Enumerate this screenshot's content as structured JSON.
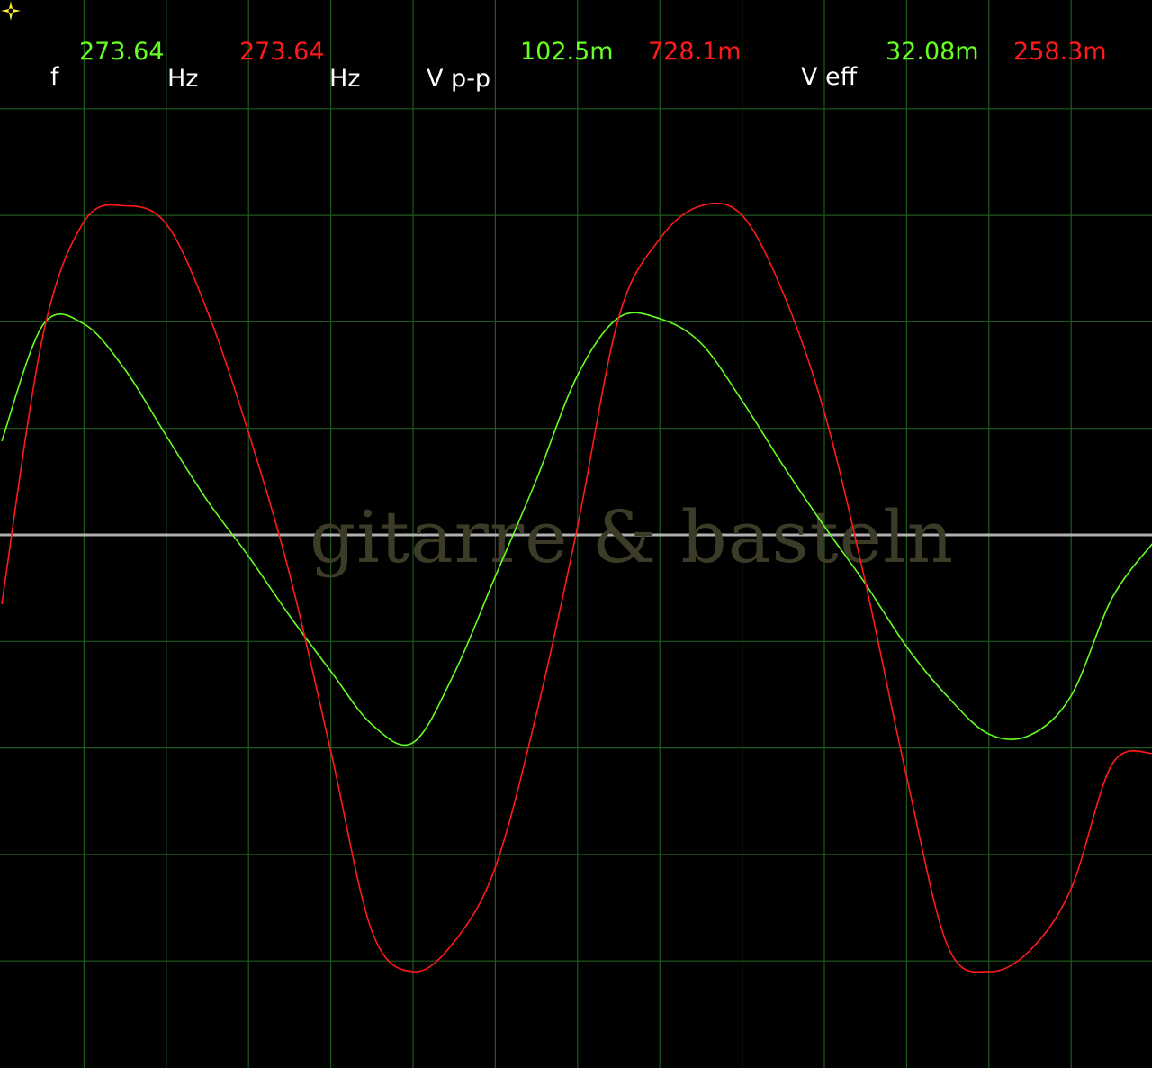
{
  "readout": {
    "freq_label": "f",
    "freq_ch1": "273.64",
    "freq_unit_ch1": "Hz",
    "freq_ch2": "273.64",
    "freq_unit_ch2": "Hz",
    "vpp_label": "V p-p",
    "vpp_ch1": "102.5m",
    "vpp_ch2": "728.1m",
    "veff_label": "V eff",
    "veff_ch1": "32.08m",
    "veff_ch2": "258.3m"
  },
  "watermark": "gitarre & basteln",
  "colors": {
    "background": "#000000",
    "grid": "#1e5a1e",
    "zero_line": "#b0b0b0",
    "channel_1": "#66ff22",
    "channel_2": "#ff1a1a",
    "cursor": "#ffee33",
    "label": "#ffffff"
  },
  "icons": {
    "cursor": "crosshair-cursor-icon"
  },
  "chart_data": {
    "type": "line",
    "grid": true,
    "series": [
      {
        "channel": 1,
        "x": [
          0,
          0.5,
          1,
          1.5,
          2,
          2.5,
          3,
          3.5,
          4,
          4.5,
          5,
          5.5,
          6,
          6.5,
          7,
          7.5,
          8,
          8.5,
          9,
          9.5,
          10,
          10.5,
          11,
          11.5,
          12,
          12.5,
          13,
          13.5,
          14
        ],
        "y": [
          0.88,
          1.97,
          1.98,
          1.55,
          0.93,
          0.32,
          -0.2,
          -0.76,
          -1.28,
          -1.78,
          -1.95,
          -1.3,
          -0.39,
          0.52,
          1.5,
          2.04,
          2.03,
          1.8,
          1.26,
          0.65,
          0.08,
          -0.46,
          -1.05,
          -1.52,
          -1.87,
          -1.88,
          -1.51,
          -0.59,
          -0.07
        ]
      },
      {
        "channel": 2,
        "x": [
          0,
          0.5,
          1,
          1.5,
          2,
          2.5,
          3,
          3.5,
          4,
          4.5,
          5,
          5.5,
          6,
          6.5,
          7,
          7.5,
          8,
          8.5,
          9,
          9.5,
          10,
          10.5,
          11,
          11.5,
          12,
          12.5,
          13,
          13.5,
          14
        ],
        "y": [
          -0.65,
          1.87,
          2.94,
          3.09,
          2.92,
          2.1,
          0.96,
          -0.37,
          -2.03,
          -3.72,
          -4.1,
          -3.82,
          -3.12,
          -1.68,
          0.08,
          2.04,
          2.78,
          3.09,
          3.0,
          2.27,
          1.15,
          -0.45,
          -2.27,
          -3.86,
          -4.1,
          -3.9,
          -3.32,
          -2.15,
          -2.05
        ]
      }
    ]
  }
}
